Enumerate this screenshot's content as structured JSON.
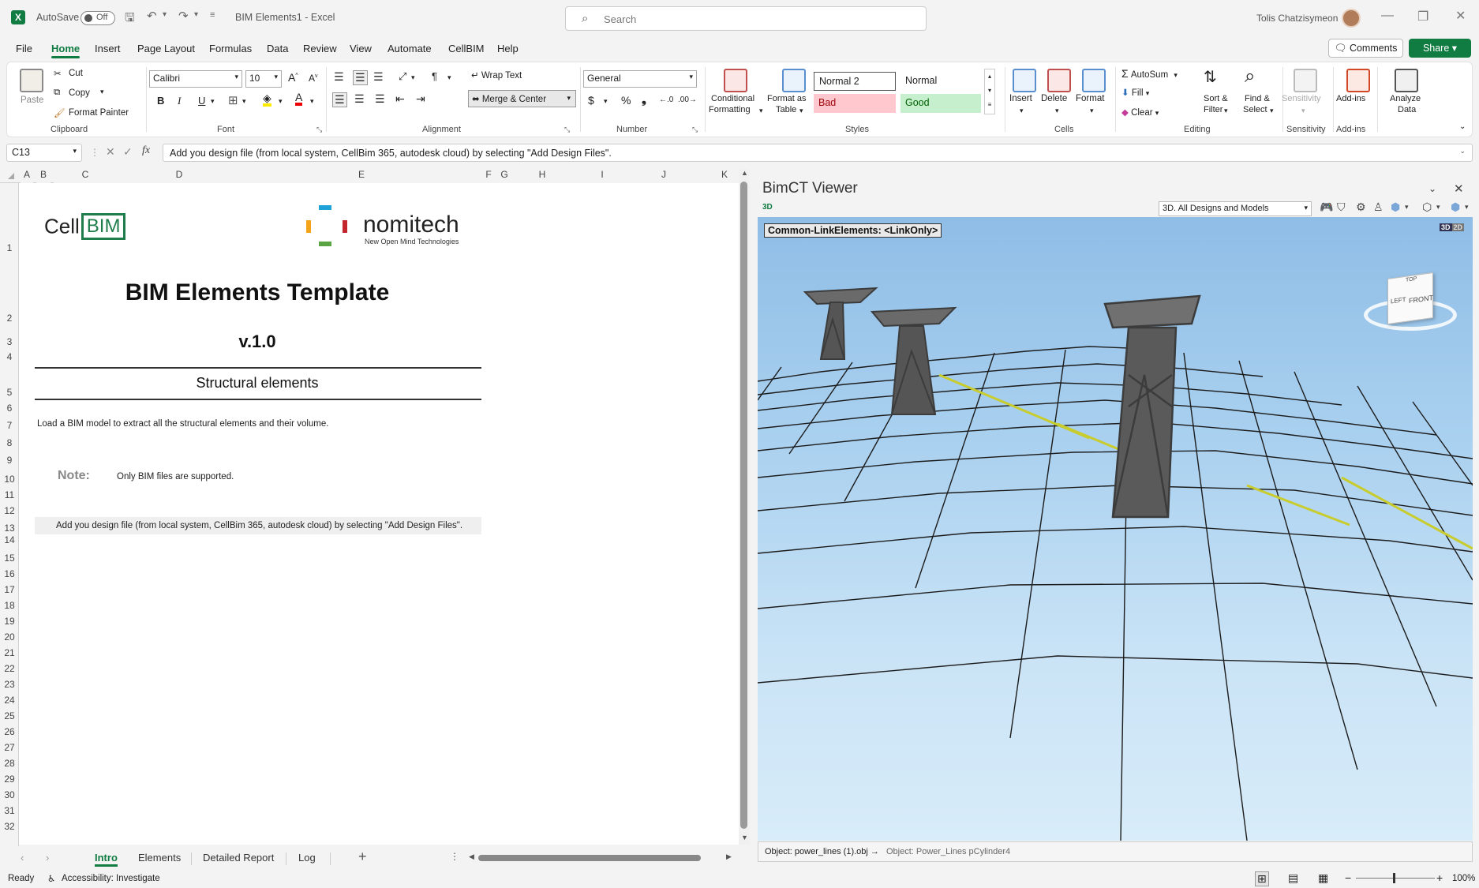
{
  "titlebar": {
    "autosave_label": "AutoSave",
    "autosave_state": "Off",
    "doc_title": "BIM Elements1",
    "app_name": "Excel",
    "title_sep": " - ",
    "search_placeholder": "Search",
    "user_name": "Tolis Chatzisymeon"
  },
  "menu": {
    "items": [
      "File",
      "Home",
      "Insert",
      "Page Layout",
      "Formulas",
      "Data",
      "Review",
      "View",
      "Automate",
      "CellBIM",
      "Help"
    ],
    "active": "Home",
    "comments": "Comments",
    "share": "Share"
  },
  "ribbon": {
    "clipboard": {
      "paste": "Paste",
      "cut": "Cut",
      "copy": "Copy",
      "format_painter": "Format Painter",
      "label": "Clipboard"
    },
    "font": {
      "name": "Calibri",
      "size": "10",
      "label": "Font"
    },
    "alignment": {
      "wrap": "Wrap Text",
      "merge": "Merge & Center",
      "label": "Alignment"
    },
    "number": {
      "format": "General",
      "label": "Number"
    },
    "styles": {
      "conditional_1": "Conditional",
      "conditional_2": "Formatting",
      "format_table_1": "Format as",
      "format_table_2": "Table",
      "normal2": "Normal 2",
      "normal": "Normal",
      "bad": "Bad",
      "good": "Good",
      "label": "Styles"
    },
    "cells": {
      "insert": "Insert",
      "delete": "Delete",
      "format": "Format",
      "label": "Cells"
    },
    "editing": {
      "autosum": "AutoSum",
      "fill": "Fill",
      "clear": "Clear",
      "sort_1": "Sort &",
      "sort_2": "Filter",
      "find_1": "Find &",
      "find_2": "Select",
      "label": "Editing"
    },
    "sensitivity": {
      "btn": "Sensitivity",
      "label": "Sensitivity"
    },
    "addins": {
      "btn": "Add-ins",
      "label": "Add-ins"
    },
    "analyze": {
      "btn_1": "Analyze",
      "btn_2": "Data"
    }
  },
  "formula_bar": {
    "name_box": "C13",
    "fx": "fx",
    "content": "Add you design file (from local system, CellBim 365, autodesk cloud) by selecting \"Add Design Files\"."
  },
  "columns": [
    "A",
    "B",
    "C",
    "D",
    "E",
    "F",
    "G",
    "H",
    "I",
    "J",
    "K"
  ],
  "rows": [
    "1",
    "2",
    "3",
    "4",
    "5",
    "6",
    "7",
    "8",
    "9",
    "10",
    "11",
    "12",
    "13",
    "14",
    "15",
    "16",
    "17",
    "18",
    "19",
    "20",
    "21",
    "22",
    "23",
    "24",
    "25",
    "26",
    "27",
    "28",
    "29",
    "30",
    "31",
    "32"
  ],
  "sheet_content": {
    "logo_cell": "Cell",
    "logo_bim": "BIM",
    "nomitech": "nomitech",
    "nomitech_tag": "New Open Mind Technologies",
    "title": "BIM Elements Template",
    "version": "v.1.0",
    "section": "Structural elements",
    "description": "Load a BIM model to extract all the structural elements and their volume.",
    "note_label": "Note:",
    "note_text": "Only BIM files are supported.",
    "instruction": "Add you design file (from local system, CellBim 365, autodesk cloud) by selecting \"Add Design Files\"."
  },
  "sheet_tabs": [
    "Intro",
    "Elements",
    "Detailed Report",
    "Log"
  ],
  "active_tab": "Intro",
  "viewer": {
    "title": "BimCT Viewer",
    "mode": "3D",
    "view_select": "3D. All Designs and Models",
    "link_label": "Common-LinkElements: <LinkOnly>",
    "toggle_3d": "3D",
    "toggle_2d": "2D",
    "cube_top": "TOP",
    "cube_left": "LEFT",
    "cube_front": "FRONT",
    "status_object": "Object: power_lines (1).obj",
    "status_arrow": "→",
    "status_sub": "Object: Power_Lines pCylinder4"
  },
  "status": {
    "ready": "Ready",
    "accessibility": "Accessibility: Investigate",
    "zoom": "100%"
  },
  "colors": {
    "excel_green": "#107c41",
    "bad_bg": "#ffc7ce",
    "bad_fg": "#9c0006",
    "good_bg": "#c6efce",
    "good_fg": "#006100"
  }
}
